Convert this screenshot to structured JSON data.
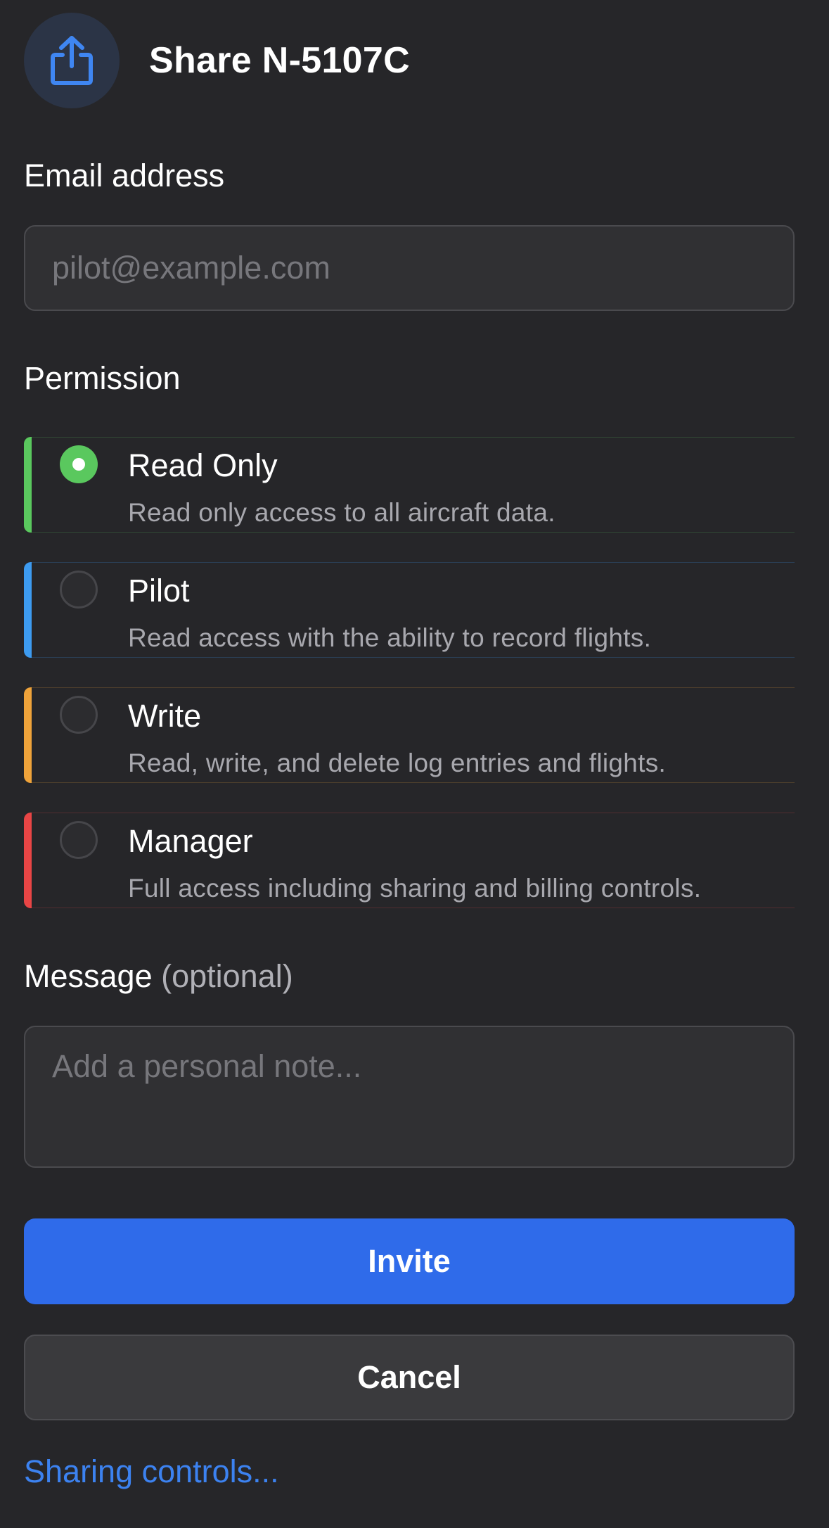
{
  "header": {
    "title": "Share N-5107C",
    "icon": "share-upload-icon"
  },
  "email": {
    "label": "Email address",
    "value": "",
    "placeholder": "pilot@example.com"
  },
  "permission": {
    "label": "Permission",
    "selected": "read_only",
    "options": [
      {
        "key": "read_only",
        "title": "Read Only",
        "description": "Read only access to all aircraft data.",
        "color": "#5ac85e"
      },
      {
        "key": "pilot",
        "title": "Pilot",
        "description": "Read access with the ability to record flights.",
        "color": "#3d9bf0"
      },
      {
        "key": "write",
        "title": "Write",
        "description": "Read, write, and delete log entries and flights.",
        "color": "#efa33a"
      },
      {
        "key": "manager",
        "title": "Manager",
        "description": "Full access including sharing and billing controls.",
        "color": "#e84545"
      }
    ]
  },
  "message": {
    "label": "Message",
    "optional_label": "(optional)",
    "value": "",
    "placeholder": "Add a personal note..."
  },
  "actions": {
    "invite_label": "Invite",
    "cancel_label": "Cancel",
    "sharing_controls_label": "Sharing controls..."
  },
  "colors": {
    "background": "#262629",
    "accent": "#2f6bea",
    "link": "#3c82f0"
  }
}
